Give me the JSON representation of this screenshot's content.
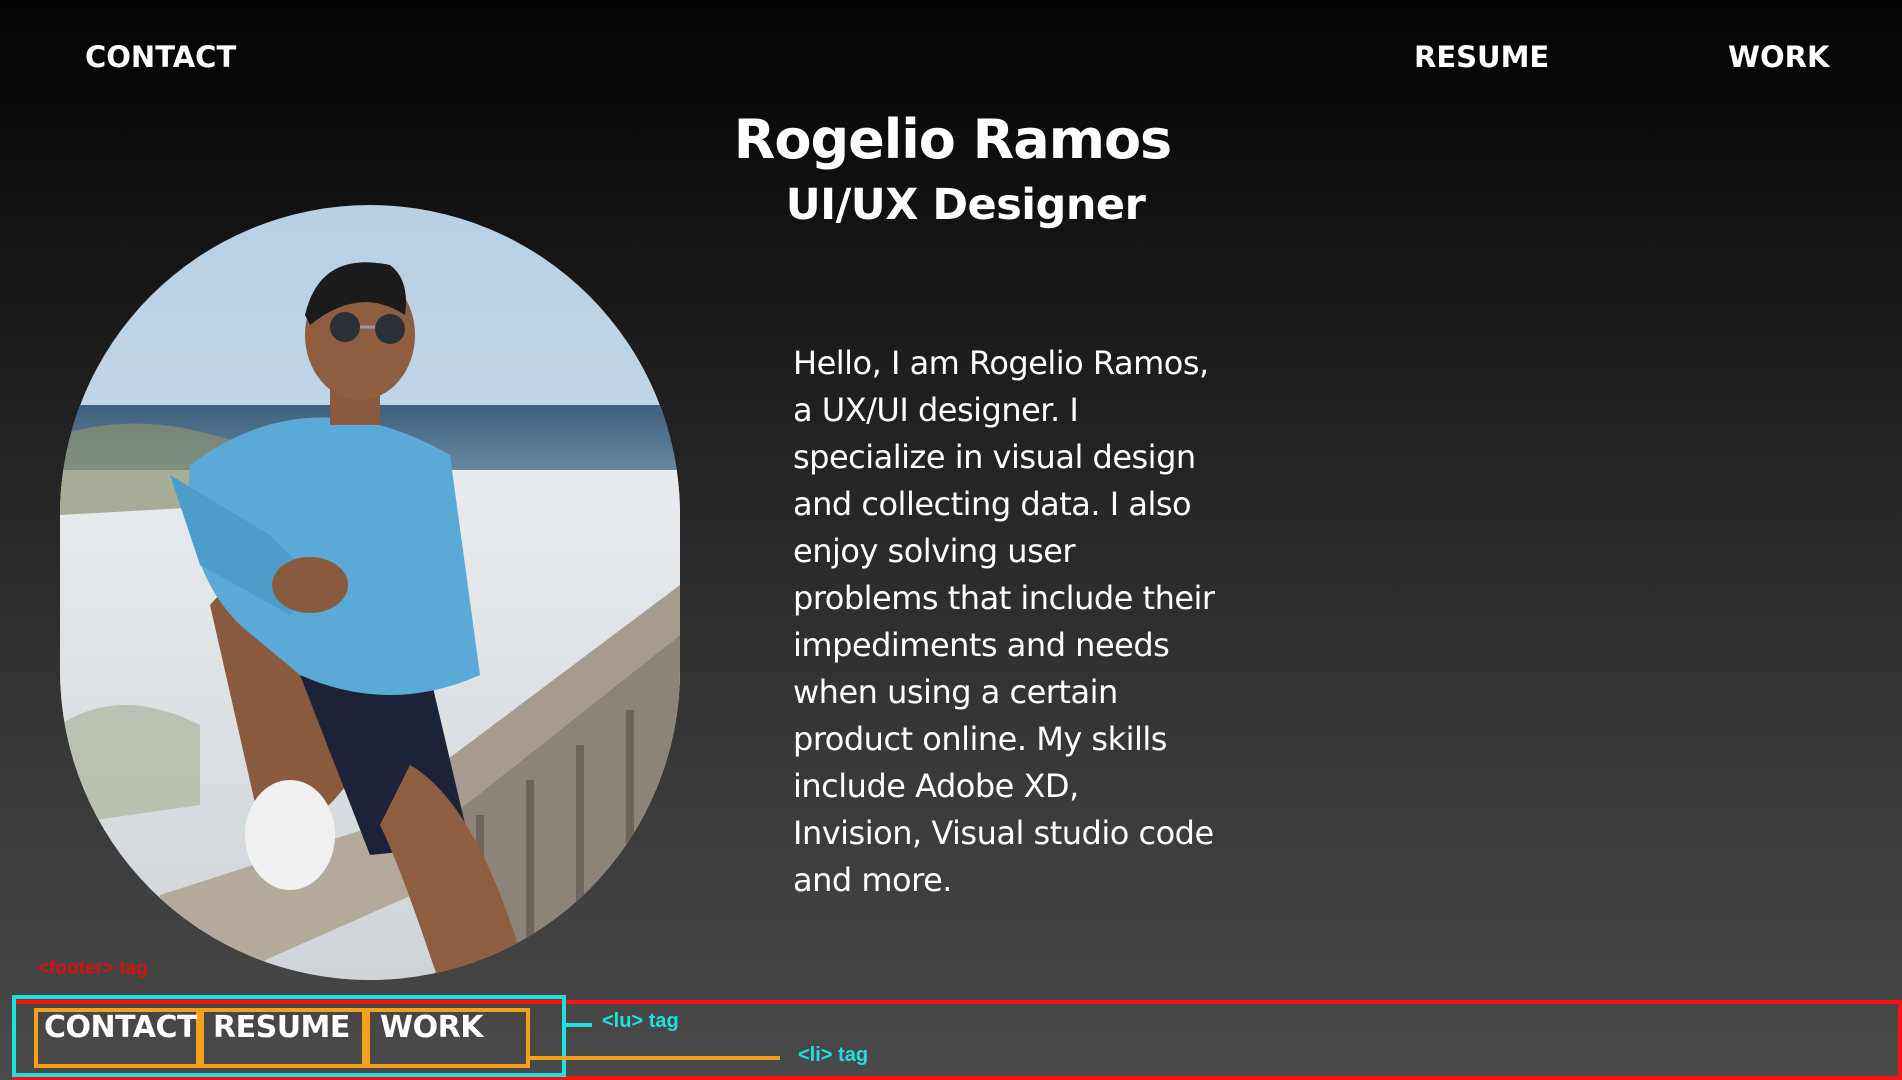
{
  "nav": {
    "contact": "CONTACT",
    "resume": "RESUME",
    "work": "WORK"
  },
  "hero": {
    "name": "Rogelio Ramos",
    "role": "UI/UX Designer",
    "bio": "Hello, I am Rogelio Ramos,\na  UX/UI designer. I\nspecialize in visual design\nand collecting data. I also\nenjoy solving user\nproblems that include their\nimpediments and needs\nwhen using a certain\nproduct online. My skills\ninclude Adobe XD,\nInvision, Visual studio code\nand more."
  },
  "footer": {
    "items": [
      "CONTACT",
      "RESUME",
      "WORK"
    ]
  },
  "annotations": {
    "footer_tag": "<footer> tag",
    "ul_tag": "<lu> tag",
    "li_tag": "<li> tag"
  },
  "colors": {
    "footer_annotation": "#ff1010",
    "ul_annotation": "#1fe0e0",
    "li_annotation": "#f5a11a"
  }
}
